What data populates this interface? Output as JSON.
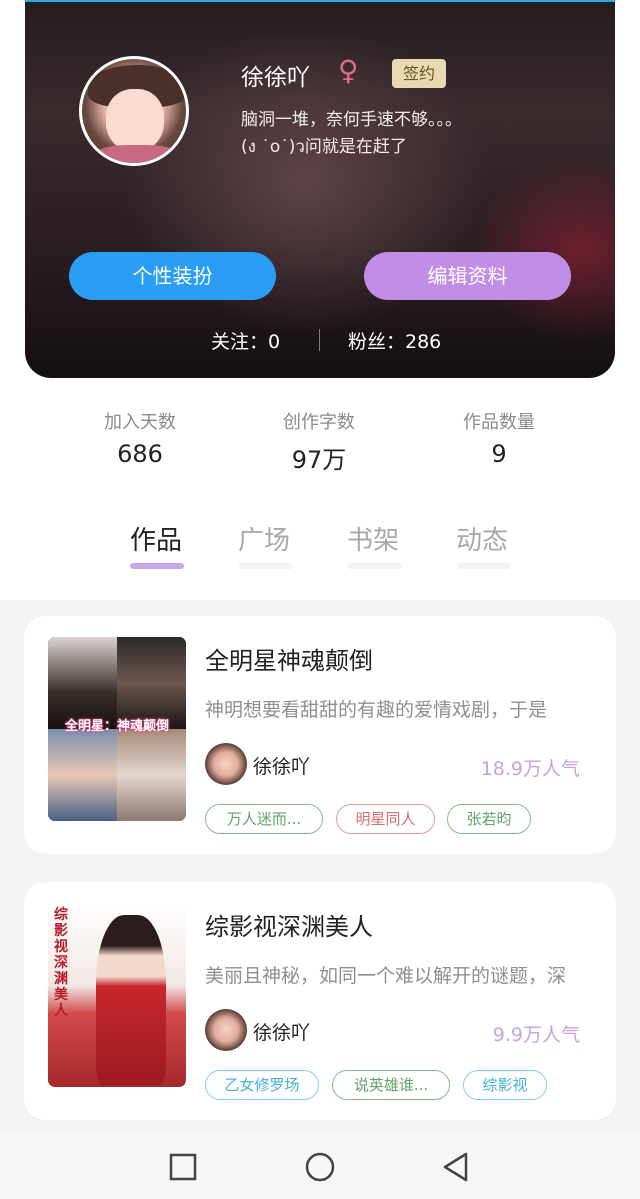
{
  "profile": {
    "name": "徐徐吖",
    "gender_icon": "♀",
    "badge": "签约",
    "bio_line1": "脑洞一堆，奈何手速不够。。。",
    "bio_line2": "(ง ˙o˙)ว问就是在赶了",
    "btn_personal": "个性装扮",
    "btn_edit": "编辑资料",
    "following": "关注：0",
    "fans": "粉丝：286"
  },
  "stats": [
    {
      "label": "加入天数",
      "value": "686"
    },
    {
      "label": "创作字数",
      "value": "97万"
    },
    {
      "label": "作品数量",
      "value": "9"
    }
  ],
  "tabs": [
    {
      "label": "作品",
      "active": true
    },
    {
      "label": "广场",
      "active": false
    },
    {
      "label": "书架",
      "active": false
    },
    {
      "label": "动态",
      "active": false
    }
  ],
  "works": [
    {
      "title": "全明星神魂颠倒",
      "cover_text": "全明星：神魂颠倒",
      "description": "神明想要看甜甜的有趣的爱情戏剧，于是",
      "author": "徐徐吖",
      "popularity": "18.9万人气",
      "tags": [
        "万人迷而...",
        "明星同人",
        "张若昀"
      ]
    },
    {
      "title": "综影视深渊美人",
      "cover_text": "综影视深渊美人",
      "description": "美丽且神秘，如同一个难以解开的谜题，深",
      "author": "徐徐吖",
      "popularity": "9.9万人气",
      "tags": [
        "乙女修罗场",
        "说英雄谁...",
        "综影视"
      ]
    }
  ],
  "colors": {
    "accent_blue": "#2a9ef5",
    "accent_purple": "#c08ee6",
    "popularity": "#c6a2e4",
    "badge_bg": "#e8d9b4"
  },
  "nav": {
    "recent_icon": "square-icon",
    "home_icon": "circle-icon",
    "back_icon": "triangle-back-icon"
  }
}
